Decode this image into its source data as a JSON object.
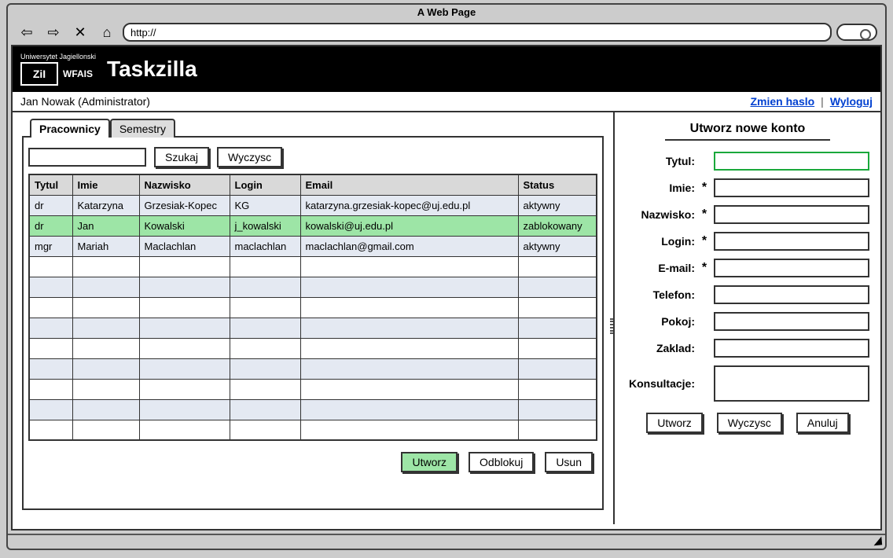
{
  "browser": {
    "title": "A Web Page",
    "url": "http://"
  },
  "header": {
    "university": "Uniwersytet Jagiellonski",
    "logo_text": "ZiI",
    "faculty": "WFAIS",
    "app_name": "Taskzilla"
  },
  "userbar": {
    "current_user": "Jan Nowak (Administrator)",
    "change_password": "Zmien haslo",
    "logout": "Wyloguj"
  },
  "tabs": [
    {
      "label": "Pracownicy",
      "active": true
    },
    {
      "label": "Semestry",
      "active": false
    }
  ],
  "search": {
    "button": "Szukaj",
    "clear": "Wyczysc",
    "value": ""
  },
  "table": {
    "columns": [
      "Tytul",
      "Imie",
      "Nazwisko",
      "Login",
      "Email",
      "Status"
    ],
    "rows": [
      {
        "tytul": "dr",
        "imie": "Katarzyna",
        "nazwisko": "Grzesiak-Kopec",
        "login": "KG",
        "email": "katarzyna.grzesiak-kopec@uj.edu.pl",
        "status": "aktywny",
        "selected": false
      },
      {
        "tytul": "dr",
        "imie": "Jan",
        "nazwisko": "Kowalski",
        "login": "j_kowalski",
        "email": "kowalski@uj.edu.pl",
        "status": "zablokowany",
        "selected": true
      },
      {
        "tytul": "mgr",
        "imie": "Mariah",
        "nazwisko": "Maclachlan",
        "login": "maclachlan",
        "email": "maclachlan@gmail.com",
        "status": "aktywny",
        "selected": false
      }
    ],
    "empty_rows": 9
  },
  "table_buttons": {
    "create": "Utworz",
    "unblock": "Odblokuj",
    "delete": "Usun"
  },
  "form": {
    "title": "Utworz nowe konto",
    "fields": {
      "tytul": {
        "label": "Tytul:",
        "required": false,
        "highlight": true
      },
      "imie": {
        "label": "Imie:",
        "required": true
      },
      "nazwisko": {
        "label": "Nazwisko:",
        "required": true
      },
      "login": {
        "label": "Login:",
        "required": true
      },
      "email": {
        "label": "E-mail:",
        "required": true
      },
      "telefon": {
        "label": "Telefon:",
        "required": false
      },
      "pokoj": {
        "label": "Pokoj:",
        "required": false
      },
      "zaklad": {
        "label": "Zaklad:",
        "required": false
      },
      "konsultacje": {
        "label": "Konsultacje:",
        "required": false,
        "tall": true
      }
    },
    "buttons": {
      "create": "Utworz",
      "clear": "Wyczysc",
      "cancel": "Anuluj"
    }
  }
}
